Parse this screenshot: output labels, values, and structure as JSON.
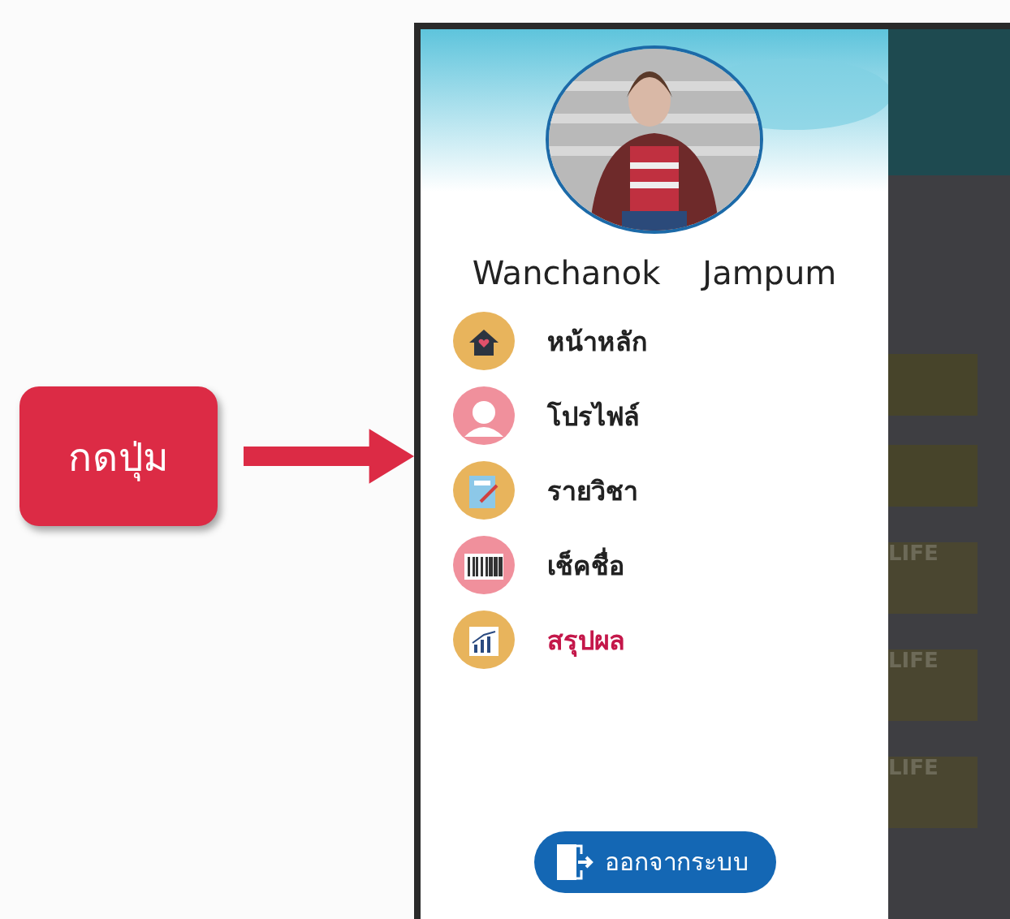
{
  "callout": {
    "label": "กดปุ่ม"
  },
  "drawer": {
    "profile": {
      "first_name": "Wanchanok",
      "last_name": "Jampum"
    },
    "menu": [
      {
        "kind": "home",
        "label": "หน้าหลัก",
        "color": "#e8b45c",
        "selected": false
      },
      {
        "kind": "profile",
        "label": "โปรไฟล์",
        "color": "#f0909c",
        "selected": false
      },
      {
        "kind": "subjects",
        "label": "รายวิชา",
        "color": "#e8b45c",
        "selected": false
      },
      {
        "kind": "attendance",
        "label": "เช็คชื่อ",
        "color": "#f0909c",
        "selected": false
      },
      {
        "kind": "summary",
        "label": "สรุปผล",
        "color": "#e8b45c",
        "selected": true
      }
    ],
    "logout_button": {
      "label": "ออกจากระบบ"
    }
  },
  "background_cards": [
    {
      "label": "LIFE"
    },
    {
      "label": "LIFE"
    },
    {
      "label": "LIFE"
    }
  ]
}
